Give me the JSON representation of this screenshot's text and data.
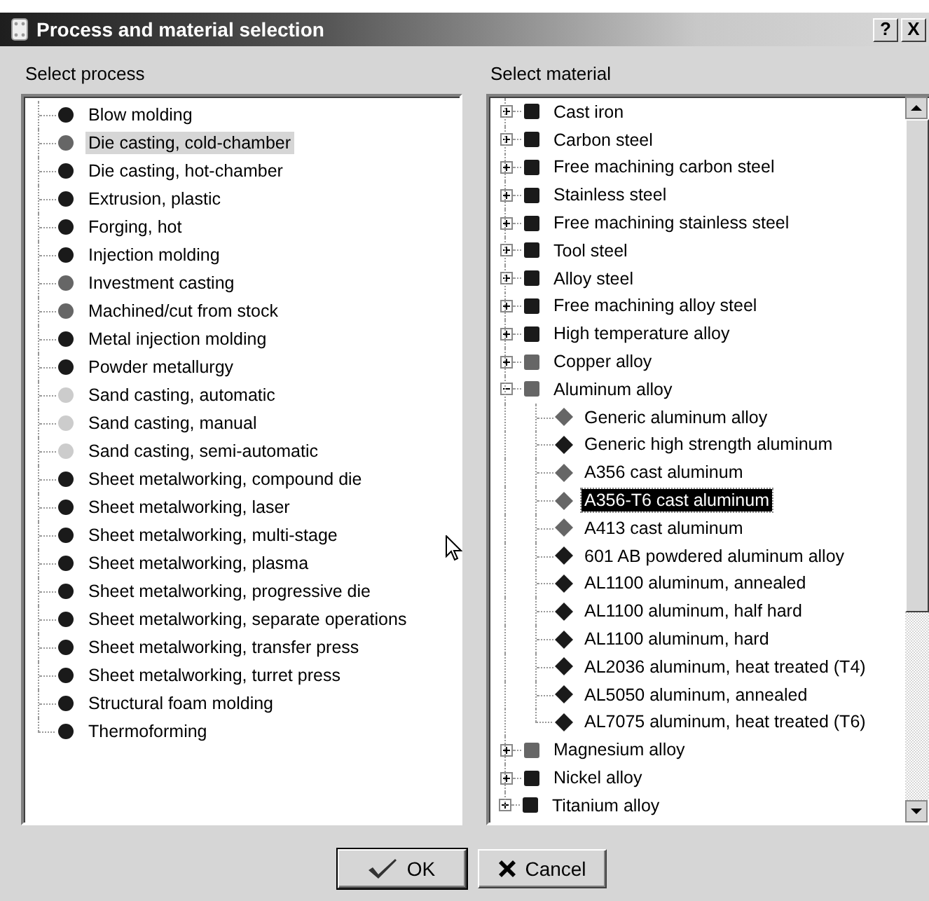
{
  "window": {
    "title": "Process and material selection",
    "help_button": "?",
    "close_button": "X"
  },
  "process_panel": {
    "label": "Select process",
    "items": [
      {
        "label": "Blow molding",
        "color": "#1a1a1a",
        "selected": false
      },
      {
        "label": "Die casting, cold-chamber",
        "color": "#666666",
        "selected": true
      },
      {
        "label": "Die casting, hot-chamber",
        "color": "#1a1a1a",
        "selected": false
      },
      {
        "label": "Extrusion, plastic",
        "color": "#1a1a1a",
        "selected": false
      },
      {
        "label": "Forging, hot",
        "color": "#1a1a1a",
        "selected": false
      },
      {
        "label": "Injection molding",
        "color": "#1a1a1a",
        "selected": false
      },
      {
        "label": "Investment casting",
        "color": "#666666",
        "selected": false
      },
      {
        "label": "Machined/cut from stock",
        "color": "#666666",
        "selected": false
      },
      {
        "label": "Metal injection molding",
        "color": "#1a1a1a",
        "selected": false
      },
      {
        "label": "Powder metallurgy",
        "color": "#1a1a1a",
        "selected": false
      },
      {
        "label": "Sand casting, automatic",
        "color": "#cccccc",
        "selected": false
      },
      {
        "label": "Sand casting, manual",
        "color": "#cccccc",
        "selected": false
      },
      {
        "label": "Sand casting, semi-automatic",
        "color": "#cccccc",
        "selected": false
      },
      {
        "label": "Sheet metalworking, compound die",
        "color": "#1a1a1a",
        "selected": false
      },
      {
        "label": "Sheet metalworking, laser",
        "color": "#1a1a1a",
        "selected": false
      },
      {
        "label": "Sheet metalworking, multi-stage",
        "color": "#1a1a1a",
        "selected": false
      },
      {
        "label": "Sheet metalworking, plasma",
        "color": "#1a1a1a",
        "selected": false
      },
      {
        "label": "Sheet metalworking, progressive die",
        "color": "#1a1a1a",
        "selected": false
      },
      {
        "label": "Sheet metalworking, separate operations",
        "color": "#1a1a1a",
        "selected": false
      },
      {
        "label": "Sheet metalworking, transfer press",
        "color": "#1a1a1a",
        "selected": false
      },
      {
        "label": "Sheet metalworking, turret press",
        "color": "#1a1a1a",
        "selected": false
      },
      {
        "label": "Structural foam molding",
        "color": "#1a1a1a",
        "selected": false
      },
      {
        "label": "Thermoforming",
        "color": "#1a1a1a",
        "selected": false
      }
    ]
  },
  "material_panel": {
    "label": "Select material",
    "groups": [
      {
        "label": "Cast iron",
        "color": "#1a1a1a",
        "expanded": false,
        "selected": false
      },
      {
        "label": "Carbon steel",
        "color": "#1a1a1a",
        "expanded": false,
        "selected": false
      },
      {
        "label": "Free machining carbon steel",
        "color": "#1a1a1a",
        "expanded": false,
        "selected": false
      },
      {
        "label": "Stainless steel",
        "color": "#1a1a1a",
        "expanded": false,
        "selected": false
      },
      {
        "label": "Free machining stainless steel",
        "color": "#1a1a1a",
        "expanded": false,
        "selected": false
      },
      {
        "label": "Tool steel",
        "color": "#1a1a1a",
        "expanded": false,
        "selected": false
      },
      {
        "label": "Alloy steel",
        "color": "#1a1a1a",
        "expanded": false,
        "selected": false
      },
      {
        "label": "Free machining alloy steel",
        "color": "#1a1a1a",
        "expanded": false,
        "selected": false
      },
      {
        "label": "High temperature alloy",
        "color": "#1a1a1a",
        "expanded": false,
        "selected": false
      },
      {
        "label": "Copper alloy",
        "color": "#666666",
        "expanded": false,
        "selected": false
      },
      {
        "label": "Aluminum alloy",
        "color": "#666666",
        "expanded": true,
        "selected": false,
        "children": [
          {
            "label": "Generic aluminum alloy",
            "color": "#666666",
            "selected": false
          },
          {
            "label": "Generic high strength aluminum",
            "color": "#1a1a1a",
            "selected": false
          },
          {
            "label": "A356 cast aluminum",
            "color": "#666666",
            "selected": false
          },
          {
            "label": "A356-T6 cast aluminum",
            "color": "#666666",
            "selected": true
          },
          {
            "label": "A413 cast aluminum",
            "color": "#666666",
            "selected": false
          },
          {
            "label": "601 AB powdered aluminum alloy",
            "color": "#1a1a1a",
            "selected": false
          },
          {
            "label": "AL1100 aluminum, annealed",
            "color": "#1a1a1a",
            "selected": false
          },
          {
            "label": "AL1100 aluminum, half hard",
            "color": "#1a1a1a",
            "selected": false
          },
          {
            "label": "AL1100 aluminum, hard",
            "color": "#1a1a1a",
            "selected": false
          },
          {
            "label": "AL2036 aluminum, heat treated (T4)",
            "color": "#1a1a1a",
            "selected": false
          },
          {
            "label": "AL5050 aluminum, annealed",
            "color": "#1a1a1a",
            "selected": false
          },
          {
            "label": "AL7075 aluminum, heat treated (T6)",
            "color": "#1a1a1a",
            "selected": false
          }
        ]
      },
      {
        "label": "Magnesium alloy",
        "color": "#666666",
        "expanded": false,
        "selected": false
      },
      {
        "label": "Nickel alloy",
        "color": "#1a1a1a",
        "expanded": false,
        "selected": false
      },
      {
        "label": "Titanium alloy",
        "color": "#1a1a1a",
        "expanded": false,
        "selected": false
      }
    ]
  },
  "buttons": [
    {
      "label": "OK",
      "kind": "ok"
    },
    {
      "label": "Cancel",
      "kind": "cancel"
    }
  ]
}
